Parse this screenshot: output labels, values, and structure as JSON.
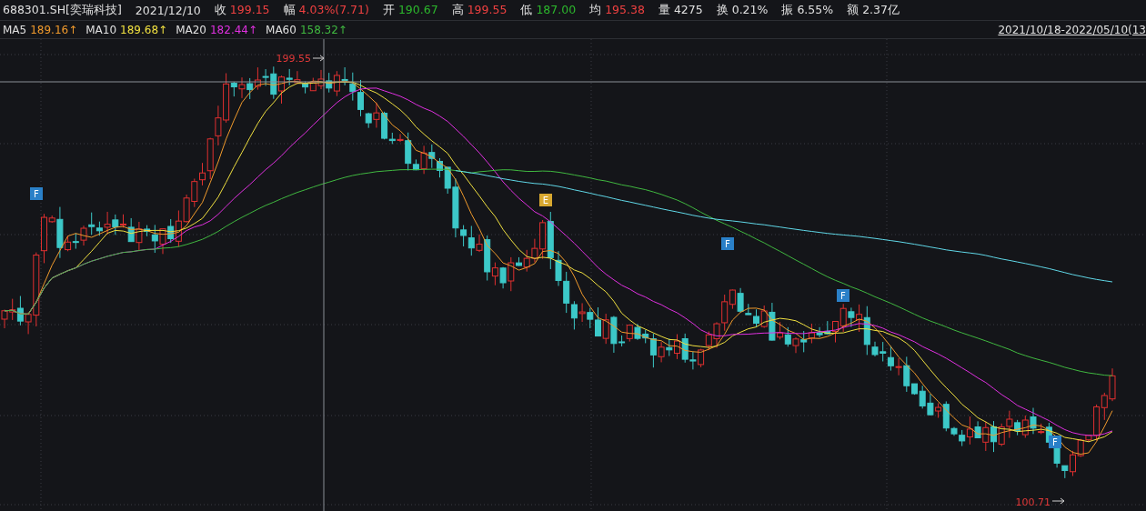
{
  "header": {
    "code": "688301.SH[奕瑞科技]",
    "date": "2021/12/10",
    "quotes": [
      {
        "label": "收",
        "value": "199.15",
        "color": "#ef4040"
      },
      {
        "label": "幅",
        "value": "4.03%(7.71)",
        "color": "#ef4040"
      },
      {
        "label": "开",
        "value": "190.67",
        "color": "#2cb82c"
      },
      {
        "label": "高",
        "value": "199.55",
        "color": "#ef4040"
      },
      {
        "label": "低",
        "value": "187.00",
        "color": "#2cb82c"
      },
      {
        "label": "均",
        "value": "195.38",
        "color": "#ef4040"
      },
      {
        "label": "量",
        "value": "4275",
        "color": "#e0e0e0"
      },
      {
        "label": "换",
        "value": "0.21%",
        "color": "#e0e0e0"
      },
      {
        "label": "振",
        "value": "6.55%",
        "color": "#e0e0e0"
      },
      {
        "label": "额",
        "value": "2.37亿",
        "color": "#e0e0e0"
      }
    ]
  },
  "legend": {
    "averages": [
      {
        "name": "MA5",
        "value": "189.16↑",
        "color": "#f09a2c"
      },
      {
        "name": "MA10",
        "value": "189.68↑",
        "color": "#f0e040"
      },
      {
        "name": "MA20",
        "value": "182.44↑",
        "color": "#e030e0"
      },
      {
        "name": "MA60",
        "value": "158.32↑",
        "color": "#40b840"
      }
    ],
    "range": "2021/10/18-2022/05/10(13"
  },
  "chart": {
    "high_label": "199.55",
    "low_label": "100.71",
    "markers": [
      {
        "label": "F",
        "color": "#2a80c8"
      },
      {
        "label": "E",
        "color": "#d8a830"
      },
      {
        "label": "F",
        "color": "#2a80c8"
      },
      {
        "label": "F",
        "color": "#2a80c8"
      },
      {
        "label": "F",
        "color": "#2a80c8"
      }
    ]
  }
}
